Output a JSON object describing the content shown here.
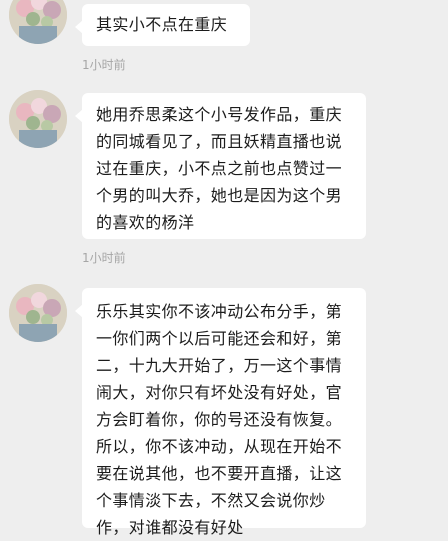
{
  "messages": [
    {
      "lines": [
        "其实小不点在重庆"
      ],
      "time": "1小时前"
    },
    {
      "lines": [
        "她用乔思柔这个小号发作品，重庆",
        "的同城看见了，而且妖精直播也说",
        "过在重庆，小不点之前也点赞过一",
        "个男的叫大乔，她也是因为这个男",
        "的喜欢的杨洋"
      ],
      "time": "1小时前"
    },
    {
      "lines": [
        "乐乐其实你不该冲动公布分手，第",
        "一你们两个以后可能还会和好，第",
        "二，十九大开始了，万一这个事情",
        "闹大，对你只有坏处没有好处，官",
        "方会盯着你，你的号还没有恢复。",
        "所以，你不该冲动，从现在开始不",
        "要在说其他，也不要开直播，让这",
        "个事情淡下去，不然又会说你炒",
        "作，对谁都没有好处"
      ]
    }
  ],
  "colors": {
    "background": "#eeeeee",
    "bubble": "#ffffff",
    "text": "#1c1c1c",
    "timestamp": "#a6a6a6"
  }
}
